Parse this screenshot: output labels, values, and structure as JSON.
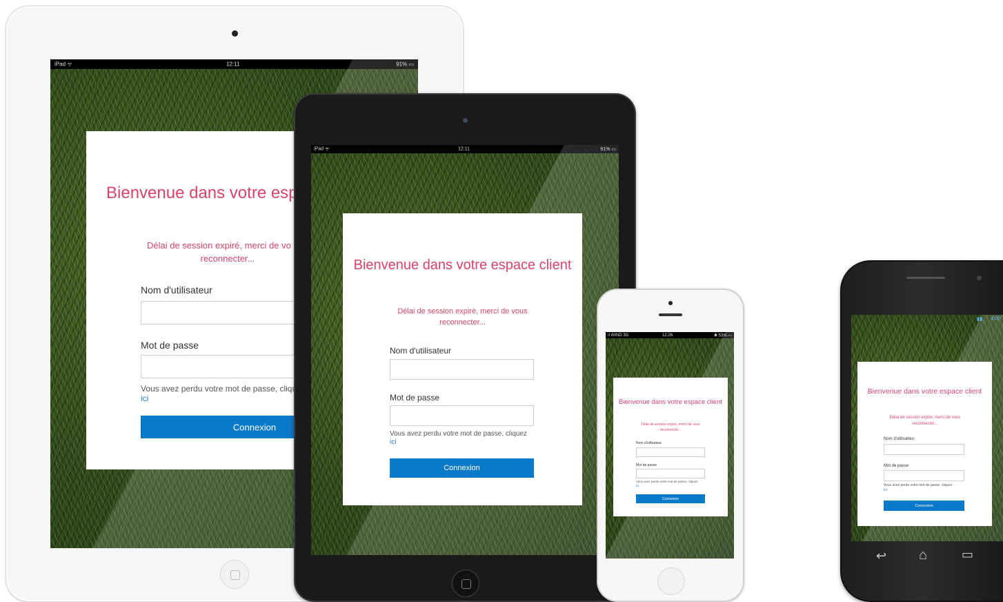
{
  "scene": {
    "devices": [
      "ipad-white",
      "ipad-mini-black",
      "iphone-white",
      "android-black"
    ]
  },
  "login": {
    "title": "Bienvenue dans votre espace client",
    "title_cropped": "Bienvenue dans votre espac",
    "message": "Délai de session expiré, merci de vous reconnecter...",
    "message_cropped_line1": "Délai de session expiré, merci de vo",
    "message_cropped_line2": "reconnecter...",
    "username_label": "Nom d'utilisateur",
    "password_label": "Mot de passe",
    "forgot_text": "Vous avez perdu votre mot de passe, cliquez",
    "forgot_text_cropped": "Vous avez perdu votre mot de passe, clique",
    "forgot_link": "ici",
    "submit_label": "Connexion"
  },
  "status_bars": {
    "ipad": {
      "carrier": "iPad ᯤ",
      "time": "12:11",
      "battery": "91% ▭"
    },
    "ipad_mini": {
      "carrier": "iPad ᯤ",
      "time": "12:11",
      "battery": "91% ▭"
    },
    "iphone": {
      "carrier": "ıl WIND 3G",
      "time": "12:26",
      "battery": "✱ 53% ▭"
    },
    "android": {
      "time": "4:00"
    }
  },
  "android_nav": {
    "back_icon": "↩",
    "home_icon": "⌂",
    "recent_icon": "▭"
  },
  "colors": {
    "title": "#d9436a",
    "button": "#0b79c9",
    "link": "#1a7fd0"
  }
}
